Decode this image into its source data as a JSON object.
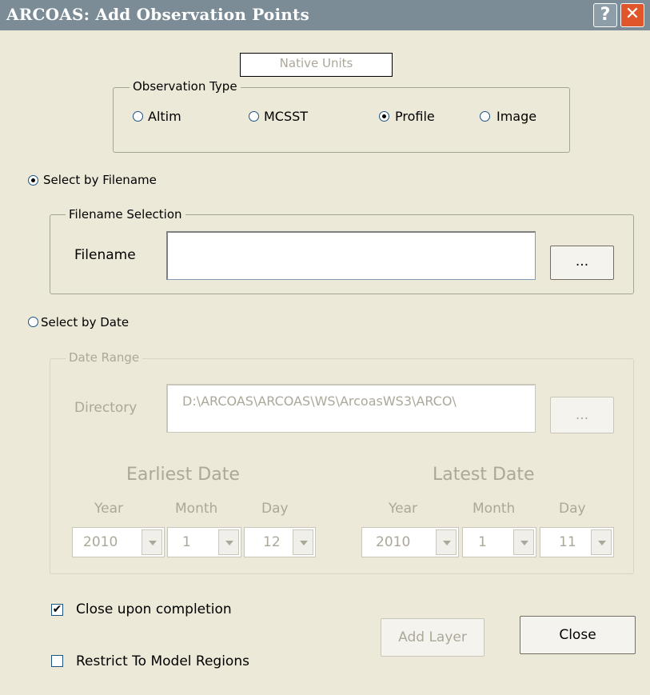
{
  "window": {
    "title": "ARCOAS:  Add Observation Points",
    "help_glyph": "?",
    "close_glyph": "✕"
  },
  "native_units": "Native Units",
  "observation_type": {
    "legend": "Observation Type",
    "options": [
      "Altim",
      "MCSST",
      "Profile",
      "Image"
    ],
    "selected": "Profile"
  },
  "select_by_filename": {
    "label": "Select by Filename",
    "selected": true,
    "group_legend": "Filename Selection",
    "filename_label": "Filename",
    "filename_value": "",
    "browse_label": "..."
  },
  "select_by_date": {
    "label": "Select by Date",
    "selected": false,
    "group_legend": "Date Range",
    "directory_label": "Directory",
    "directory_value": "D:\\ARCOAS\\ARCOAS\\WS\\ArcoasWS3\\ARCO\\",
    "browse_label": "...",
    "earliest": {
      "heading": "Earliest Date",
      "year_label": "Year",
      "month_label": "Month",
      "day_label": "Day",
      "year": "2010",
      "month": "1",
      "day": "12"
    },
    "latest": {
      "heading": "Latest Date",
      "year_label": "Year",
      "month_label": "Month",
      "day_label": "Day",
      "year": "2010",
      "month": "1",
      "day": "11"
    }
  },
  "options": {
    "close_upon_completion_label": "Close upon completion",
    "close_upon_completion_checked": true,
    "restrict_label": "Restrict To Model Regions",
    "restrict_checked": false
  },
  "buttons": {
    "add_layer": "Add Layer",
    "close": "Close"
  }
}
